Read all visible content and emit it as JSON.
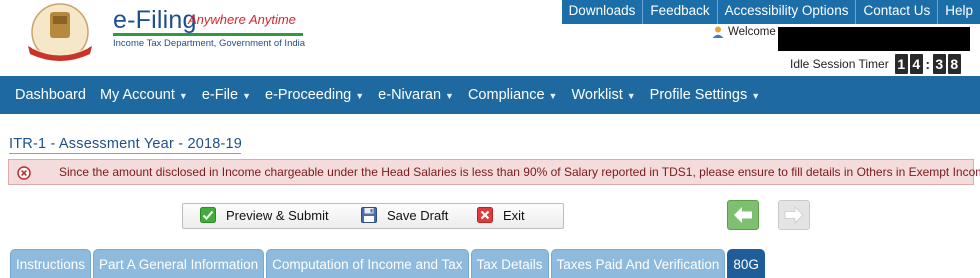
{
  "header": {
    "logo_main": "e-Filing",
    "logo_tagline": "Anywhere Anytime",
    "logo_sub": "Income Tax Department, Government of India",
    "emblem_icon": "india-emblem-icon",
    "top_links": [
      "Downloads",
      "Feedback",
      "Accessibility Options",
      "Contact Us",
      "Help"
    ],
    "welcome_label": "Welcome",
    "idle_label": "Idle Session Timer",
    "idle_digits": [
      "1",
      "4",
      "3",
      "8"
    ]
  },
  "nav": {
    "items": [
      {
        "label": "Dashboard",
        "dropdown": false
      },
      {
        "label": "My Account",
        "dropdown": true
      },
      {
        "label": "e-File",
        "dropdown": true
      },
      {
        "label": "e-Proceeding",
        "dropdown": true
      },
      {
        "label": "e-Nivaran",
        "dropdown": true
      },
      {
        "label": "Compliance",
        "dropdown": true
      },
      {
        "label": "Worklist",
        "dropdown": true
      },
      {
        "label": "Profile Settings",
        "dropdown": true
      }
    ]
  },
  "form": {
    "title": "ITR-1 - Assessment Year - 2018-19",
    "error_message": "Since the amount disclosed in Income chargeable under the Head Salaries is less than 90% of Salary reported in TDS1, please ensure to fill details in Others in Exempt Income"
  },
  "actions": {
    "preview_submit": "Preview & Submit",
    "save_draft": "Save Draft",
    "exit": "Exit"
  },
  "tabs": [
    {
      "label": "Instructions",
      "active": false
    },
    {
      "label": "Part A General Information",
      "active": false
    },
    {
      "label": "Computation of Income and Tax",
      "active": false
    },
    {
      "label": "Tax Details",
      "active": false
    },
    {
      "label": "Taxes Paid And Verification",
      "active": false
    },
    {
      "label": "80G",
      "active": true
    }
  ],
  "colors": {
    "brand_blue": "#1e6aa0",
    "error_bg": "#f5dcdc",
    "active_tab": "#1e5d99"
  }
}
